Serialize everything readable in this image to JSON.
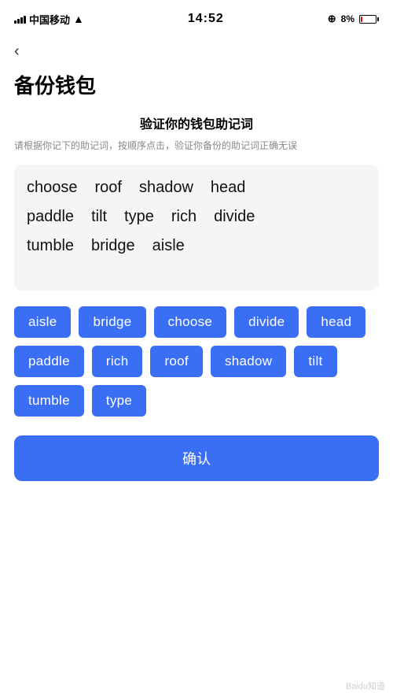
{
  "statusBar": {
    "carrier": "中国移动",
    "time": "14:52",
    "batteryPercent": "8%",
    "batteryLow": true
  },
  "back": {
    "arrowSymbol": "‹"
  },
  "pageTitle": "备份钱包",
  "section": {
    "heading": "验证你的钱包助记词",
    "description": "请根据你记下的助记词，按顺序点击，验证你备份的助记词正确无误"
  },
  "displayWords": {
    "row1": [
      "choose",
      "roof",
      "shadow",
      "head"
    ],
    "row2": [
      "paddle",
      "tilt",
      "type",
      "rich",
      "divide"
    ],
    "row3": [
      "tumble",
      "bridge",
      "aisle"
    ]
  },
  "chips": [
    "aisle",
    "bridge",
    "choose",
    "divide",
    "head",
    "paddle",
    "rich",
    "roof",
    "shadow",
    "tilt",
    "tumble",
    "type"
  ],
  "confirmButton": {
    "label": "确认"
  },
  "watermark": "Baidu知道"
}
